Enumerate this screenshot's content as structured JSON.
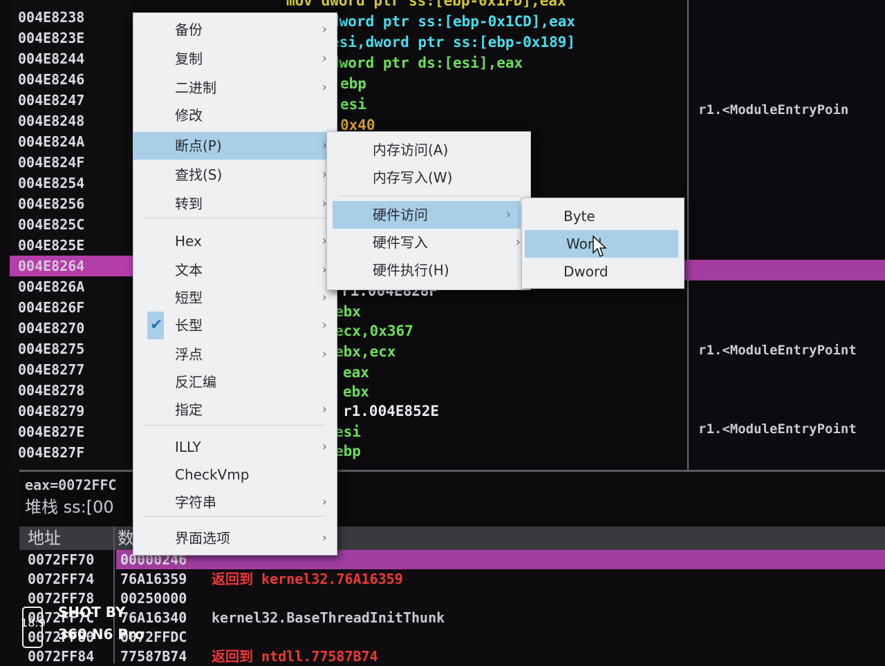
{
  "disasm": {
    "addresses": [
      "004E8238",
      "004E823E",
      "004E8244",
      "004E8246",
      "004E8247",
      "004E8248",
      "004E824A",
      "004E824F",
      "004E8254",
      "004E8256",
      "004E825C",
      "004E825E",
      "004E8264",
      "004E826A",
      "004E826F",
      "004E8270",
      "004E8275",
      "004E8277",
      "004E8278",
      "004E8279",
      "004E827E",
      "004E827F"
    ],
    "code_lines": [
      {
        "text": "mov dword ptr ss:[ebp-0x1FD],eax",
        "color": "c-yellow"
      },
      {
        "text": "dword ptr ss:[ebp-0x1CD],eax",
        "color": "c-cyan"
      },
      {
        "text": "esi,dword ptr ss:[ebp-0x189]",
        "color": "c-cyan"
      },
      {
        "text": "dword ptr ds:[esi],eax",
        "color": "c-green"
      },
      {
        "text": "ebp",
        "color": "c-green"
      },
      {
        "text": "esi",
        "color": "c-green"
      },
      {
        "text": "0x40",
        "color": "c-orange"
      },
      {
        "text": "r1.004E828F",
        "color": "c-white"
      },
      {
        "text": "ebx",
        "color": "c-green"
      },
      {
        "text": "ecx,0x367",
        "color": "c-green"
      },
      {
        "text": "ebx,ecx",
        "color": "c-green"
      },
      {
        "text": "eax",
        "color": "c-green"
      },
      {
        "text": "ebx",
        "color": "c-green"
      },
      {
        "text": "r1.004E852E",
        "color": "c-white"
      },
      {
        "text": "esi",
        "color": "c-green"
      },
      {
        "text": "ebp",
        "color": "c-green"
      }
    ],
    "comments": [
      "r1.<ModuleEntryPoin",
      "r1.<ModuleEntryPoint",
      "r1.<ModuleEntryPoint"
    ]
  },
  "info": {
    "line1": "eax=0072FFC",
    "line2": "堆栈 ss:[00"
  },
  "stack": {
    "header_addr": "地址",
    "header_val": "数",
    "rows": [
      {
        "addr": "0072FF70",
        "val": "00000246",
        "cmt": "",
        "cmt_color": "c-white"
      },
      {
        "addr": "0072FF74",
        "val": "76A16359",
        "cmt": "返回到 kernel32.76A16359",
        "cmt_color": "c-red"
      },
      {
        "addr": "0072FF78",
        "val": "00250000",
        "cmt": "",
        "cmt_color": "c-white"
      },
      {
        "addr": "0072FF7C",
        "val": "76A16340",
        "cmt": "kernel32.BaseThreadInitThunk",
        "cmt_color": "c-gray"
      },
      {
        "addr": "0072FF80",
        "val": "0072FFDC",
        "cmt": "",
        "cmt_color": "c-white"
      },
      {
        "addr": "0072FF84",
        "val": "77587B74",
        "cmt": "返回到 ntdll.77587B74",
        "cmt_color": "c-red"
      }
    ]
  },
  "menu_main": {
    "items": [
      "备份",
      "复制",
      "二进制",
      "修改",
      "断点(P)",
      "查找(S)",
      "转到",
      "Hex",
      "文本",
      "短型",
      "长型",
      "浮点",
      "反汇编",
      "指定",
      "ILLY",
      "CheckVmp",
      "字符串",
      "界面选项"
    ]
  },
  "menu_breakpoint": {
    "items": [
      "内存访问(A)",
      "内存写入(W)",
      "硬件访问",
      "硬件写入",
      "硬件执行(H)"
    ]
  },
  "menu_hw_access": {
    "items": [
      "Byte",
      "Word",
      "Dword"
    ]
  },
  "watermark": {
    "line1": "SHOT BY",
    "line2": "360 N6 Pro",
    "time": "18:9"
  },
  "icons": {
    "arrow": "chevron-right-icon",
    "check": "checkmark-icon",
    "cursor": "mouse-pointer-icon"
  },
  "colors": {
    "selection": "#a23ea0",
    "menu_highlight": "#a9cfe8",
    "menu_bg": "#eef0f2"
  }
}
